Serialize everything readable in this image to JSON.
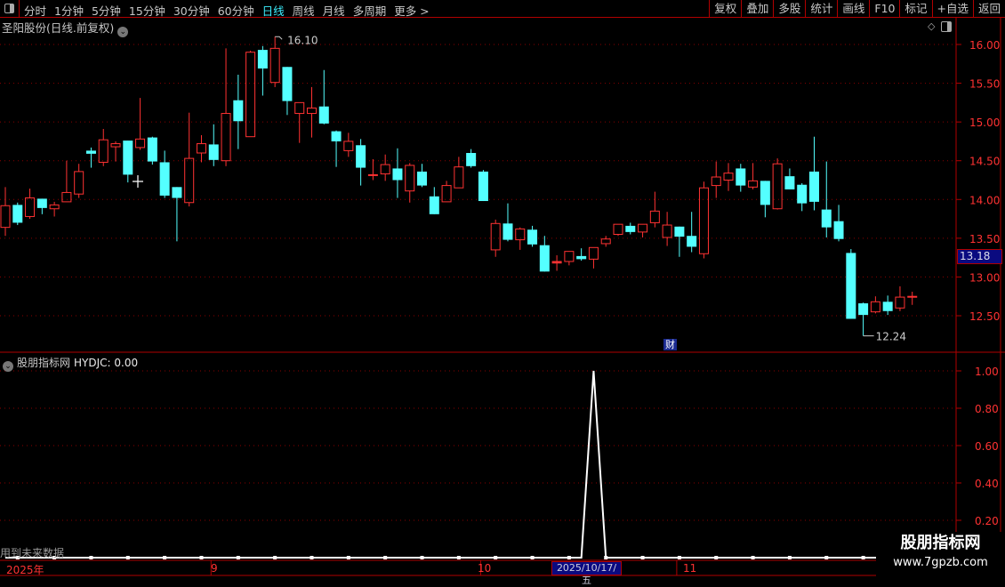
{
  "toolbar": {
    "periods": [
      "分时",
      "1分钟",
      "5分钟",
      "15分钟",
      "30分钟",
      "60分钟",
      "日线",
      "周线",
      "月线",
      "多周期",
      "更多 >"
    ],
    "active_period": "日线",
    "actions": [
      "复权",
      "叠加",
      "多股",
      "统计",
      "画线",
      "F10",
      "标记",
      "+自选",
      "返回"
    ]
  },
  "stock_title": "圣阳股份(日线.前复权)",
  "price_axis": {
    "ticks": [
      "16.00",
      "15.50",
      "15.00",
      "14.50",
      "14.00",
      "13.50",
      "13.00",
      "12.50"
    ]
  },
  "cursor_price": "13.18",
  "annotations": {
    "high": "16.10",
    "low": "12.24"
  },
  "finance_marker": "财",
  "indicator": {
    "name": "股朋指标网",
    "value_label": "HYDJC: 0.00",
    "ticks": [
      "1.00",
      "0.80",
      "0.60",
      "0.40",
      "0.20"
    ]
  },
  "future_data_note": "用到未来数据",
  "date_axis": {
    "labels": [
      "2025年",
      "9",
      "10",
      "11"
    ],
    "cursor_date": "2025/10/17/五"
  },
  "watermark": {
    "name": "股朋指标网",
    "url": "www.7gpzb.com"
  },
  "colors": {
    "up": "#ff3232",
    "down": "#54ffff",
    "grid": "#8a0000",
    "border": "#b00000",
    "indicator_line": "#ffffff"
  },
  "chart_data": [
    {
      "type": "candlestick",
      "fields": [
        "open",
        "high",
        "low",
        "close"
      ],
      "ylim": [
        12.2,
        16.2
      ],
      "grid": true,
      "ohlc": [
        [
          13.64,
          14.16,
          13.53,
          13.92
        ],
        [
          13.93,
          13.96,
          13.67,
          13.7
        ],
        [
          13.78,
          14.14,
          13.75,
          14.02
        ],
        [
          14.01,
          14.01,
          13.81,
          13.89
        ],
        [
          13.88,
          13.97,
          13.78,
          13.93
        ],
        [
          13.97,
          14.5,
          13.97,
          14.09
        ],
        [
          14.07,
          14.46,
          14.02,
          14.36
        ],
        [
          14.63,
          14.67,
          14.41,
          14.59
        ],
        [
          14.48,
          14.91,
          14.43,
          14.77
        ],
        [
          14.68,
          14.75,
          14.49,
          14.72
        ],
        [
          14.76,
          14.76,
          14.22,
          14.32
        ],
        [
          14.67,
          15.31,
          14.64,
          14.78
        ],
        [
          14.8,
          14.81,
          14.45,
          14.49
        ],
        [
          14.48,
          14.63,
          14.02,
          14.05
        ],
        [
          14.16,
          14.16,
          13.46,
          14.02
        ],
        [
          13.96,
          15.12,
          13.91,
          14.53
        ],
        [
          14.6,
          14.83,
          14.48,
          14.72
        ],
        [
          14.71,
          14.97,
          14.43,
          14.51
        ],
        [
          14.5,
          15.95,
          14.43,
          15.11
        ],
        [
          15.28,
          15.61,
          14.65,
          15.01
        ],
        [
          14.81,
          15.92,
          14.81,
          15.9
        ],
        [
          15.93,
          15.98,
          15.34,
          15.69
        ],
        [
          15.51,
          16.1,
          15.45,
          15.95
        ],
        [
          15.71,
          15.71,
          15.09,
          15.27
        ],
        [
          15.11,
          15.25,
          14.73,
          15.25
        ],
        [
          15.11,
          15.45,
          14.8,
          15.18
        ],
        [
          15.2,
          15.67,
          14.97,
          14.98
        ],
        [
          14.88,
          14.89,
          14.42,
          14.75
        ],
        [
          14.63,
          14.86,
          14.55,
          14.75
        ],
        [
          14.7,
          14.78,
          14.18,
          14.41
        ],
        [
          14.31,
          14.52,
          14.25,
          14.32
        ],
        [
          14.33,
          14.58,
          14.24,
          14.45
        ],
        [
          14.4,
          14.66,
          14.02,
          14.25
        ],
        [
          14.11,
          14.47,
          13.96,
          14.44
        ],
        [
          14.36,
          14.46,
          14.16,
          14.18
        ],
        [
          14.04,
          14.16,
          13.81,
          13.81
        ],
        [
          13.97,
          14.24,
          13.97,
          14.18
        ],
        [
          14.15,
          14.55,
          14.15,
          14.42
        ],
        [
          14.6,
          14.65,
          14.41,
          14.43
        ],
        [
          14.36,
          14.38,
          13.98,
          13.98
        ],
        [
          13.35,
          13.74,
          13.26,
          13.69
        ],
        [
          13.69,
          13.95,
          13.46,
          13.48
        ],
        [
          13.48,
          13.64,
          13.35,
          13.62
        ],
        [
          13.61,
          13.66,
          13.39,
          13.42
        ],
        [
          13.41,
          13.53,
          13.07,
          13.07
        ],
        [
          13.18,
          13.28,
          13.08,
          13.2
        ],
        [
          13.2,
          13.33,
          13.15,
          13.33
        ],
        [
          13.27,
          13.37,
          13.21,
          13.23
        ],
        [
          13.23,
          13.38,
          13.11,
          13.38
        ],
        [
          13.43,
          13.53,
          13.39,
          13.49
        ],
        [
          13.55,
          13.68,
          13.53,
          13.68
        ],
        [
          13.66,
          13.7,
          13.55,
          13.58
        ],
        [
          13.58,
          13.68,
          13.51,
          13.68
        ],
        [
          13.7,
          14.1,
          13.64,
          13.85
        ],
        [
          13.51,
          13.84,
          13.4,
          13.67
        ],
        [
          13.65,
          13.65,
          13.26,
          13.52
        ],
        [
          13.53,
          13.84,
          13.32,
          13.39
        ],
        [
          13.3,
          14.23,
          13.24,
          14.15
        ],
        [
          14.18,
          14.49,
          14.02,
          14.29
        ],
        [
          14.25,
          14.47,
          14.11,
          14.34
        ],
        [
          14.4,
          14.46,
          14.1,
          14.18
        ],
        [
          14.16,
          14.47,
          14.13,
          14.24
        ],
        [
          14.24,
          14.24,
          13.77,
          13.93
        ],
        [
          13.88,
          14.53,
          13.87,
          14.46
        ],
        [
          14.3,
          14.4,
          14.13,
          14.13
        ],
        [
          14.19,
          14.21,
          13.85,
          13.95
        ],
        [
          14.36,
          14.81,
          13.86,
          13.97
        ],
        [
          13.87,
          14.49,
          13.51,
          13.64
        ],
        [
          13.72,
          13.93,
          13.46,
          13.49
        ],
        [
          13.31,
          13.36,
          12.46,
          12.46
        ],
        [
          12.66,
          12.67,
          12.24,
          12.51
        ],
        [
          12.55,
          12.75,
          12.53,
          12.68
        ],
        [
          12.68,
          12.76,
          12.51,
          12.56
        ],
        [
          12.6,
          12.88,
          12.56,
          12.74
        ],
        [
          12.74,
          12.81,
          12.64,
          12.75
        ]
      ]
    },
    {
      "type": "line",
      "series": [
        {
          "name": "HYDJC",
          "values": [
            0,
            0,
            0,
            0,
            0,
            0,
            0,
            0,
            0,
            0,
            0,
            0,
            0,
            0,
            0,
            0,
            0,
            0,
            0,
            0,
            0,
            0,
            0,
            0,
            0,
            0,
            0,
            0,
            0,
            0,
            0,
            0,
            0,
            0,
            0,
            0,
            0,
            0,
            0,
            0,
            0,
            0,
            0,
            0,
            0,
            0,
            0,
            0,
            1,
            0,
            0,
            0,
            0,
            0,
            0,
            0,
            0,
            0,
            0,
            0,
            0,
            0,
            0,
            0,
            0,
            0,
            0,
            0,
            0,
            0,
            0,
            0,
            0,
            0,
            0
          ]
        }
      ],
      "ylim": [
        0,
        1.05
      ]
    }
  ]
}
